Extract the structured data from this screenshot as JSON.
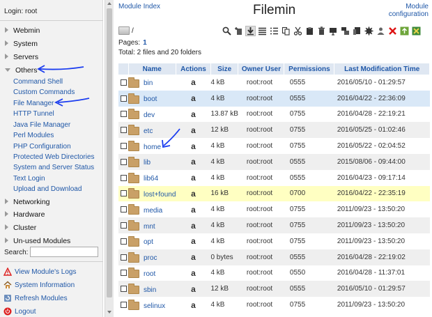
{
  "sidebar": {
    "login": "Login: root",
    "categories_top": [
      {
        "label": "Webmin"
      },
      {
        "label": "System"
      },
      {
        "label": "Servers"
      },
      {
        "label": "Others"
      }
    ],
    "modules": [
      "Command Shell",
      "Custom Commands",
      "File Manager",
      "HTTP Tunnel",
      "Java File Manager",
      "Perl Modules",
      "PHP Configuration",
      "Protected Web Directories",
      "System and Server Status",
      "Text Login",
      "Upload and Download"
    ],
    "categories_bottom": [
      {
        "label": "Networking"
      },
      {
        "label": "Hardware"
      },
      {
        "label": "Cluster"
      },
      {
        "label": "Un-used Modules"
      }
    ],
    "search_label": "Search:",
    "search_value": "",
    "actions": [
      {
        "label": "View Module's Logs",
        "icon": "warning-icon"
      },
      {
        "label": "System Information",
        "icon": "home-icon"
      },
      {
        "label": "Refresh Modules",
        "icon": "refresh-icon"
      },
      {
        "label": "Logout",
        "icon": "power-icon"
      }
    ]
  },
  "header": {
    "module_index": "Module Index",
    "title": "Filemin",
    "module_config": "Module configuration"
  },
  "toolbar": {
    "icons": [
      "search-icon",
      "new-file-icon",
      "download-icon",
      "list-view-icon",
      "detail-view-icon",
      "copy-icon",
      "cut-icon",
      "paste-icon",
      "delete-icon",
      "move-icon",
      "rename-icon",
      "settings-icon",
      "user-icon",
      "close-icon",
      "upload-icon",
      "extract-icon"
    ]
  },
  "path": "/",
  "pages_label": "Pages:",
  "page_current": "1",
  "total": "Total: 2 files and 20 folders",
  "table": {
    "columns": [
      "Name",
      "Actions",
      "Size",
      "Owner User",
      "Permissions",
      "Last Modification Time"
    ],
    "rows": [
      {
        "name": "bin",
        "action": "a",
        "size": "4 kB",
        "owner": "root:root",
        "perm": "0555",
        "date": "2016/05/10 - 01:29:57",
        "style": "odd"
      },
      {
        "name": "boot",
        "action": "a",
        "size": "4 kB",
        "owner": "root:root",
        "perm": "0555",
        "date": "2016/04/22 - 22:36:09",
        "style": "sel"
      },
      {
        "name": "dev",
        "action": "a",
        "size": "13.87 kB",
        "owner": "root:root",
        "perm": "0755",
        "date": "2016/04/28 - 22:19:21",
        "style": "odd"
      },
      {
        "name": "etc",
        "action": "a",
        "size": "12 kB",
        "owner": "root:root",
        "perm": "0755",
        "date": "2016/05/25 - 01:02:46",
        "style": "even"
      },
      {
        "name": "home",
        "action": "a",
        "size": "4 kB",
        "owner": "root:root",
        "perm": "0755",
        "date": "2016/05/22 - 02:04:52",
        "style": "odd"
      },
      {
        "name": "lib",
        "action": "a",
        "size": "4 kB",
        "owner": "root:root",
        "perm": "0555",
        "date": "2015/08/06 - 09:44:00",
        "style": "even"
      },
      {
        "name": "lib64",
        "action": "a",
        "size": "4 kB",
        "owner": "root:root",
        "perm": "0555",
        "date": "2016/04/23 - 09:17:14",
        "style": "odd"
      },
      {
        "name": "lost+found",
        "action": "a",
        "size": "16 kB",
        "owner": "root:root",
        "perm": "0700",
        "date": "2016/04/22 - 22:35:19",
        "style": "hl"
      },
      {
        "name": "media",
        "action": "a",
        "size": "4 kB",
        "owner": "root:root",
        "perm": "0755",
        "date": "2011/09/23 - 13:50:20",
        "style": "odd"
      },
      {
        "name": "mnt",
        "action": "a",
        "size": "4 kB",
        "owner": "root:root",
        "perm": "0755",
        "date": "2011/09/23 - 13:50:20",
        "style": "even"
      },
      {
        "name": "opt",
        "action": "a",
        "size": "4 kB",
        "owner": "root:root",
        "perm": "0755",
        "date": "2011/09/23 - 13:50:20",
        "style": "odd"
      },
      {
        "name": "proc",
        "action": "a",
        "size": "0 bytes",
        "owner": "root:root",
        "perm": "0555",
        "date": "2016/04/28 - 22:19:02",
        "style": "even"
      },
      {
        "name": "root",
        "action": "a",
        "size": "4 kB",
        "owner": "root:root",
        "perm": "0550",
        "date": "2016/04/28 - 11:37:01",
        "style": "odd"
      },
      {
        "name": "sbin",
        "action": "a",
        "size": "12 kB",
        "owner": "root:root",
        "perm": "0555",
        "date": "2016/05/10 - 01:29:57",
        "style": "even"
      },
      {
        "name": "selinux",
        "action": "a",
        "size": "4 kB",
        "owner": "root:root",
        "perm": "0755",
        "date": "2011/09/23 - 13:50:20",
        "style": "odd"
      }
    ]
  },
  "colors": {
    "link": "#1f57a7",
    "header_bg": "#dfe7f2",
    "selected_row": "#d9e8f7",
    "highlight_row": "#ffffc2",
    "annotation_arrow": "#1a3cf0"
  }
}
